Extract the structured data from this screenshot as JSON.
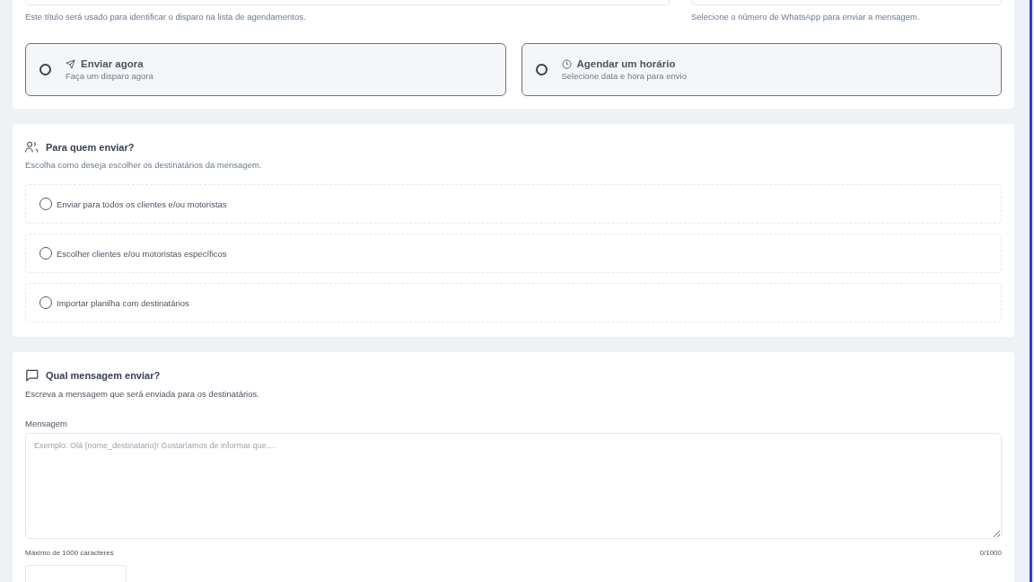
{
  "schedule_section": {
    "title_field": {
      "hint": "Este título será usado para identificar o disparo na lista de agendamentos."
    },
    "whatsapp_field": {
      "hint": "Selecione o número de WhatsApp para enviar a mensagem."
    },
    "send_options": [
      {
        "kind": "send",
        "title": "Enviar agora",
        "subtitle": "Faça um disparo agora",
        "selected": false
      },
      {
        "kind": "clock",
        "title": "Agendar um horário",
        "subtitle": "Selecione data e hora para envio",
        "selected": false
      }
    ]
  },
  "recipients_section": {
    "title": "Para quem enviar?",
    "description": "Escolha como deseja escolher os destinatários da mensagem.",
    "options": [
      {
        "label": "Enviar para todos os clientes e/ou motoristas",
        "selected": false
      },
      {
        "label": "Escolher clientes e/ou motoristas específicos",
        "selected": false
      },
      {
        "label": "Importar planilha com destinatários",
        "selected": false
      }
    ]
  },
  "message_section": {
    "title": "Qual mensagem enviar?",
    "description": "Escreva a mensagem que será enviada para os destinatários.",
    "field_label": "Mensagem",
    "placeholder": "Exemplo: Olá {nome_destinatario}! Gostaríamos de informar que....",
    "limit_hint": "Máximo de 1000 caracteres",
    "counter": "0/1000"
  }
}
